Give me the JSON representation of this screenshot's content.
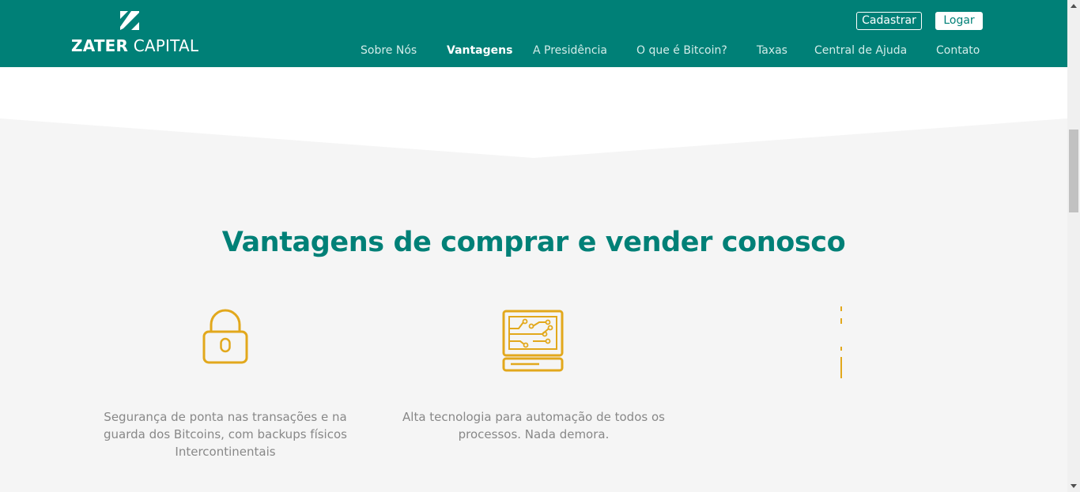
{
  "brand": {
    "name_bold": "ZATER",
    "name_light": "CAPITAL"
  },
  "header": {
    "register_label": "Cadastrar",
    "login_label": "Logar",
    "nav": [
      {
        "label": "Sobre Nós",
        "active": false
      },
      {
        "label": "Vantagens",
        "active": true
      },
      {
        "label": "A Presidência",
        "active": false
      },
      {
        "label": "O que é Bitcoin?",
        "active": false
      },
      {
        "label": "Taxas",
        "active": false
      },
      {
        "label": "Central de Ajuda",
        "active": false
      },
      {
        "label": "Contato",
        "active": false
      }
    ]
  },
  "advantages": {
    "title": "Vantagens de comprar e vender conosco",
    "items": [
      {
        "icon": "lock-icon",
        "text": "Segurança de ponta nas transações e na guarda dos Bitcoins, com backups físicos Intercontinentais"
      },
      {
        "icon": "computer-circuit-icon",
        "text": "Alta tecnologia para automação de todos os processos. Nada demora."
      }
    ]
  },
  "colors": {
    "brand": "#008077",
    "accent": "#e2a81c",
    "text_muted": "#888888",
    "section_bg": "#f5f5f5"
  }
}
